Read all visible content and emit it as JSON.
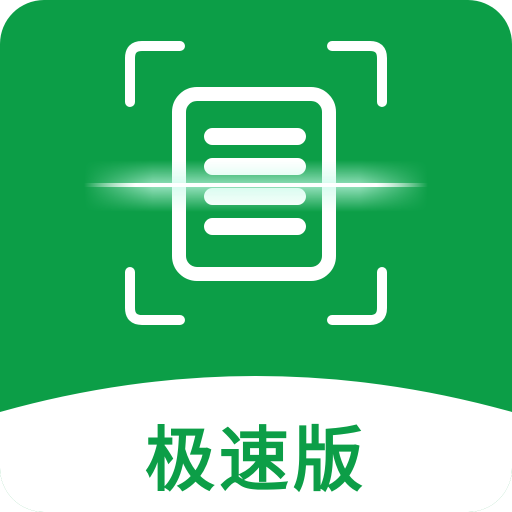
{
  "icon": {
    "label": "极速版",
    "symbol": "document-scan-icon",
    "colors": {
      "brand_green": "#0c9e47",
      "white": "#ffffff",
      "scan_glow": "#a8f3de"
    }
  }
}
